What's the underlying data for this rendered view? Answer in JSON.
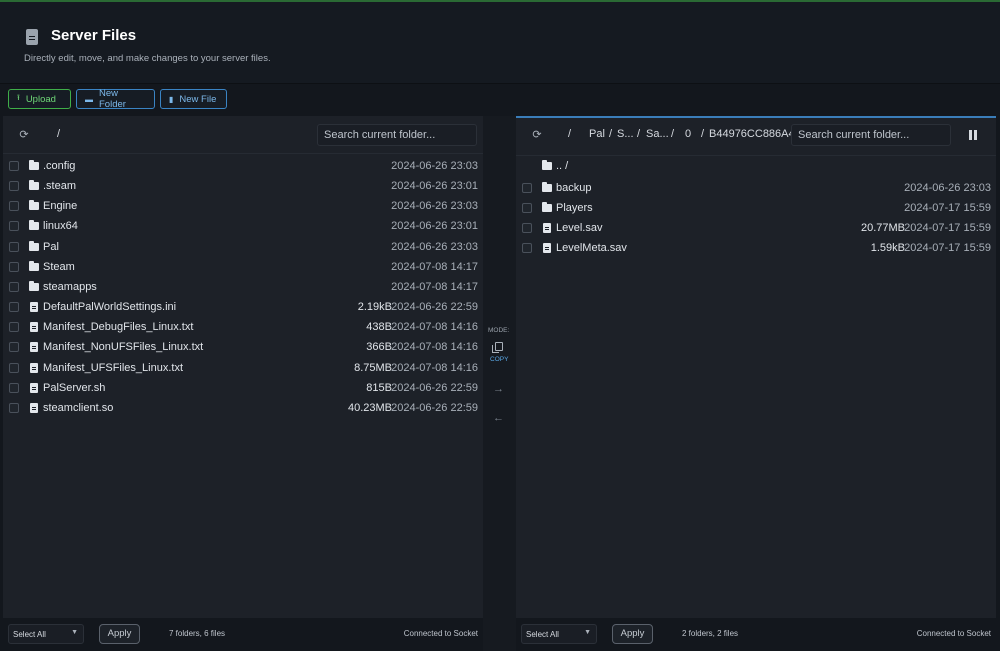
{
  "header": {
    "title": "Server Files",
    "subtitle": "Directly edit, move, and make changes to your server files."
  },
  "toolbar": {
    "upload_label": "Upload",
    "new_folder_label": "New Folder",
    "new_file_label": "New File"
  },
  "left_pane": {
    "path": [
      "/"
    ],
    "search_placeholder": "Search current folder...",
    "items": [
      {
        "type": "folder",
        "name": ".config",
        "size": "",
        "date": "2024-06-26 23:03"
      },
      {
        "type": "folder",
        "name": ".steam",
        "size": "",
        "date": "2024-06-26 23:01"
      },
      {
        "type": "folder",
        "name": "Engine",
        "size": "",
        "date": "2024-06-26 23:03"
      },
      {
        "type": "folder",
        "name": "linux64",
        "size": "",
        "date": "2024-06-26 23:01"
      },
      {
        "type": "folder",
        "name": "Pal",
        "size": "",
        "date": "2024-06-26 23:03"
      },
      {
        "type": "folder",
        "name": "Steam",
        "size": "",
        "date": "2024-07-08 14:17"
      },
      {
        "type": "folder",
        "name": "steamapps",
        "size": "",
        "date": "2024-07-08 14:17"
      },
      {
        "type": "file",
        "name": "DefaultPalWorldSettings.ini",
        "size": "2.19kB",
        "date": "2024-06-26 22:59"
      },
      {
        "type": "file",
        "name": "Manifest_DebugFiles_Linux.txt",
        "size": "438B",
        "date": "2024-07-08 14:16"
      },
      {
        "type": "file",
        "name": "Manifest_NonUFSFiles_Linux.txt",
        "size": "366B",
        "date": "2024-07-08 14:16"
      },
      {
        "type": "file",
        "name": "Manifest_UFSFiles_Linux.txt",
        "size": "8.75MB",
        "date": "2024-07-08 14:16"
      },
      {
        "type": "file",
        "name": "PalServer.sh",
        "size": "815B",
        "date": "2024-06-26 22:59"
      },
      {
        "type": "file",
        "name": "steamclient.so",
        "size": "40.23MB",
        "date": "2024-06-26 22:59"
      }
    ],
    "footer": {
      "select_label": "Select All",
      "apply_label": "Apply",
      "count": "7 folders, 6 files",
      "status": "Connected to Socket"
    }
  },
  "middle": {
    "mode_label": "MODE:",
    "mode_value": "COPY",
    "copy_icon": "copy-icon",
    "arrow_right": "→",
    "arrow_left": "←"
  },
  "right_pane": {
    "path": [
      "/",
      "Pal",
      "/",
      "S...",
      "/",
      "Sa...",
      "/",
      "0",
      "/",
      "B44976CC886A4"
    ],
    "search_placeholder": "Search current folder...",
    "parent_label": ".. /",
    "items": [
      {
        "type": "folder",
        "name": "backup",
        "size": "",
        "date": "2024-06-26 23:03"
      },
      {
        "type": "folder",
        "name": "Players",
        "size": "",
        "date": "2024-07-17 15:59"
      },
      {
        "type": "file",
        "name": "Level.sav",
        "size": "20.77MB",
        "date": "2024-07-17 15:59"
      },
      {
        "type": "file",
        "name": "LevelMeta.sav",
        "size": "1.59kB",
        "date": "2024-07-17 15:59"
      }
    ],
    "footer": {
      "select_label": "Select All",
      "apply_label": "Apply",
      "count": "2 folders, 2 files",
      "status": "Connected to Socket"
    }
  },
  "colors": {
    "upload_accent": "#3fae49",
    "folder_accent": "#3a84c4",
    "background": "#13171d",
    "pane": "#1d2128"
  }
}
